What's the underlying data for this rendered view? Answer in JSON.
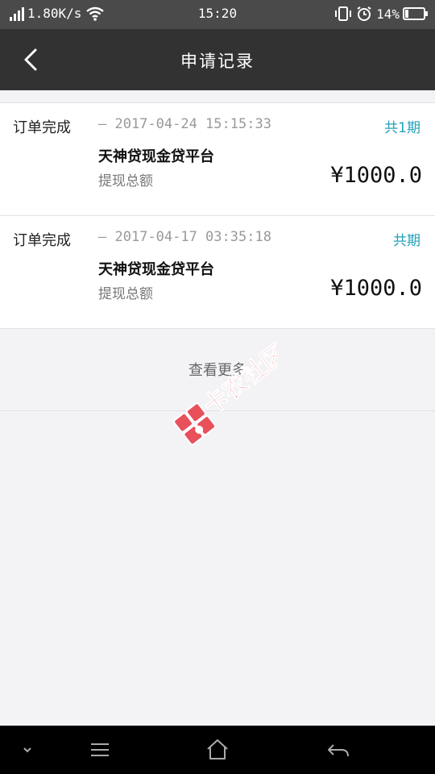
{
  "status_bar": {
    "speed": "1.80K/s",
    "time": "15:20",
    "battery": "14%"
  },
  "header": {
    "title": "申请记录"
  },
  "records": [
    {
      "status": "订单完成",
      "time": "— 2017-04-24 15:15:33",
      "period": "共1期",
      "platform": "天神贷现金贷平台",
      "amount_label": "提现总额",
      "amount": "¥1000.0"
    },
    {
      "status": "订单完成",
      "time": "— 2017-04-17 03:35:18",
      "period": "共期",
      "platform": "天神贷现金贷平台",
      "amount_label": "提现总额",
      "amount": "¥1000.0"
    }
  ],
  "load_more": "查看更多",
  "watermark_text": "卡农社区",
  "colors": {
    "status_bar_bg": "#4a4a4a",
    "title_bar_bg": "#323232",
    "accent": "#22a0b9",
    "watermark": "#e8505b",
    "nav_bar_bg": "#000000"
  },
  "icons": {
    "back": "chevron-left-icon",
    "signal": "signal-icon",
    "wifi": "wifi-icon",
    "vibrate": "vibrate-icon",
    "alarm": "alarm-icon",
    "battery": "battery-icon",
    "nav_down": "chevron-down-icon",
    "nav_menu": "menu-icon",
    "nav_home": "home-icon",
    "nav_back": "back-arrow-icon"
  }
}
